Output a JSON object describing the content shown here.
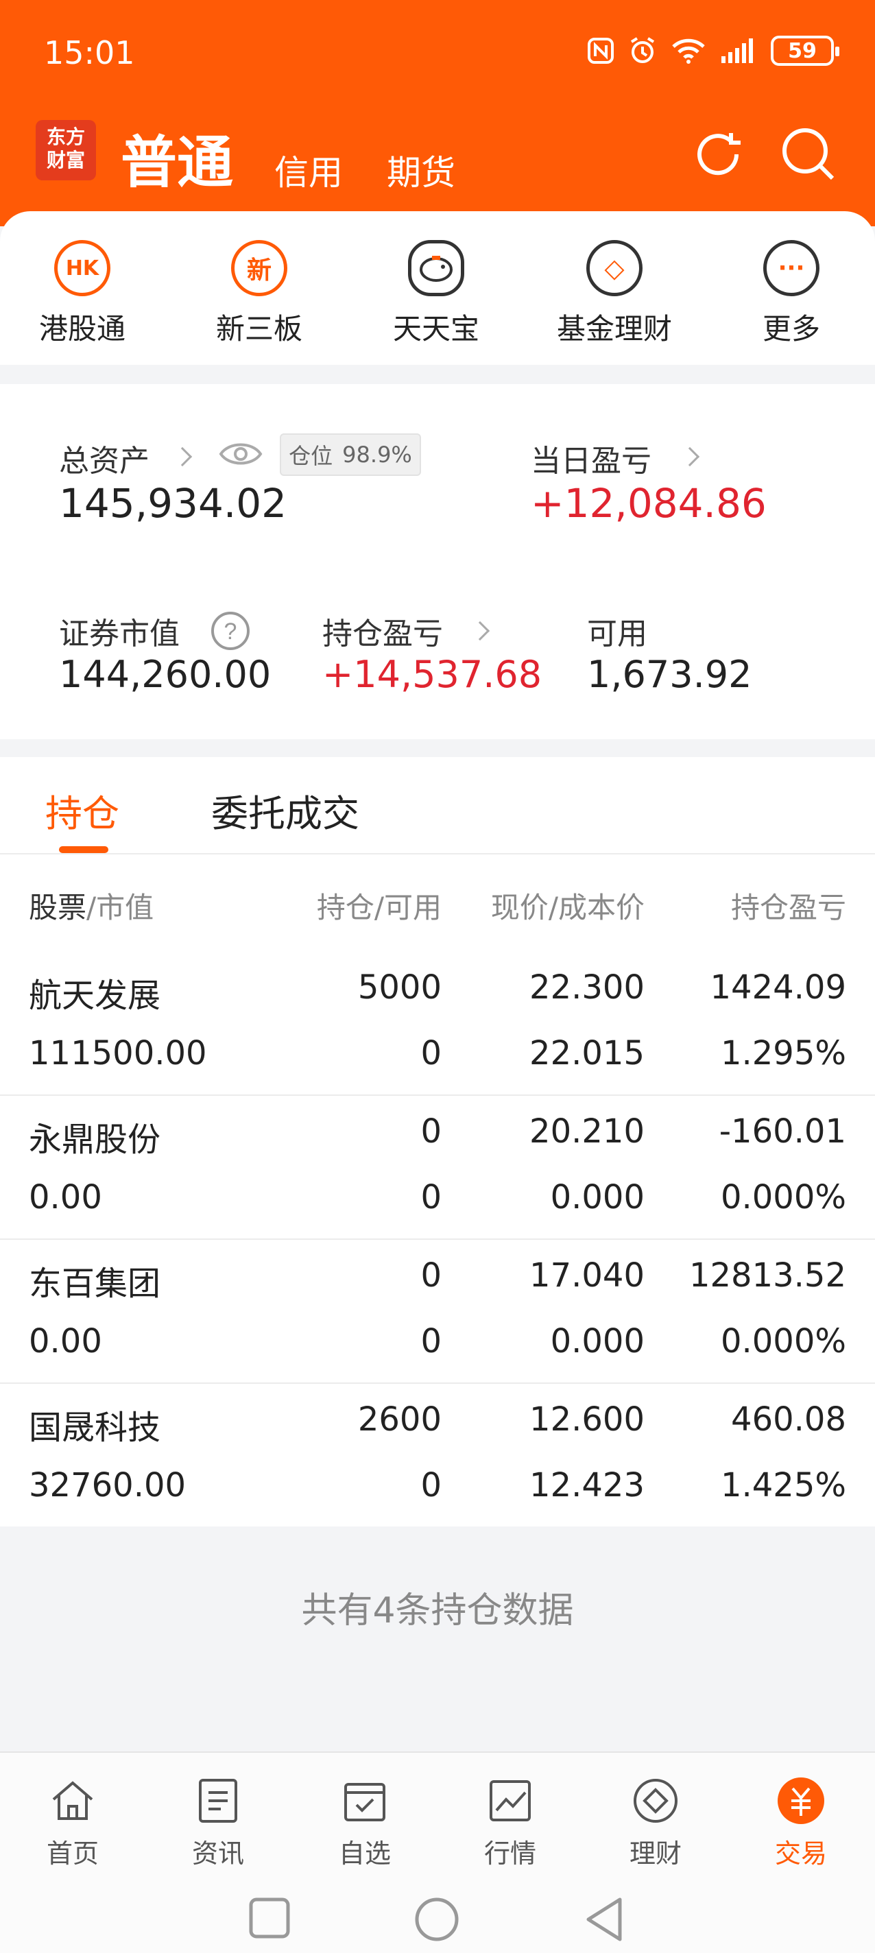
{
  "status": {
    "time": "15:01",
    "battery": "59"
  },
  "header": {
    "logo": [
      "东方",
      "财富"
    ],
    "tabs": [
      "普通",
      "信用",
      "期货"
    ]
  },
  "quick_menu": [
    {
      "label": "港股通",
      "icon": "hk-icon",
      "glyph": "HK"
    },
    {
      "label": "新三板",
      "icon": "new-board-icon",
      "glyph": "新"
    },
    {
      "label": "天天宝",
      "icon": "piggy-bank-icon",
      "glyph": ""
    },
    {
      "label": "基金理财",
      "icon": "fund-diamond-icon",
      "glyph": "◇"
    },
    {
      "label": "更多",
      "icon": "more-icon",
      "glyph": "···"
    }
  ],
  "summary": {
    "total_assets_label": "总资产",
    "position_label": "仓位",
    "position_value": "98.9%",
    "total_assets": "145,934.02",
    "daily_pl_label": "当日盈亏",
    "daily_pl": "+12,084.86",
    "market_value_label": "证券市值",
    "market_value": "144,260.00",
    "holding_pl_label": "持仓盈亏",
    "holding_pl": "+14,537.68",
    "available_label": "可用",
    "available": "1,673.92"
  },
  "list_tabs": [
    "持仓",
    "委托成交"
  ],
  "columns": {
    "stock": "股票",
    "stock_sub": "/市值",
    "holding": "持仓/可用",
    "price": "现价/成本价",
    "pl": "持仓盈亏"
  },
  "holdings": [
    {
      "name": "航天发展",
      "value": "111500.00",
      "hold": "5000",
      "avail": "0",
      "price": "22.300",
      "cost": "22.015",
      "pl": "1424.09",
      "pl_pct": "1.295%",
      "pl_color": "red",
      "pct_color": "red"
    },
    {
      "name": "永鼎股份",
      "value": "0.00",
      "hold": "0",
      "avail": "0",
      "price": "20.210",
      "cost": "0.000",
      "pl": "-160.01",
      "pl_pct": "0.000%",
      "pl_color": "green",
      "pct_color": "green"
    },
    {
      "name": "东百集团",
      "value": "0.00",
      "hold": "0",
      "avail": "0",
      "price": "17.040",
      "cost": "0.000",
      "pl": "12813.52",
      "pl_pct": "0.000%",
      "pl_color": "red",
      "pct_color": "red"
    },
    {
      "name": "国晟科技",
      "value": "32760.00",
      "hold": "2600",
      "avail": "0",
      "price": "12.600",
      "cost": "12.423",
      "pl": "460.08",
      "pl_pct": "1.425%",
      "pl_color": "red",
      "pct_color": "red"
    }
  ],
  "footer_note": "共有4条持仓数据",
  "bottom_nav": [
    {
      "label": "首页",
      "icon": "home-icon"
    },
    {
      "label": "资讯",
      "icon": "news-icon"
    },
    {
      "label": "自选",
      "icon": "watchlist-icon"
    },
    {
      "label": "行情",
      "icon": "market-chart-icon"
    },
    {
      "label": "理财",
      "icon": "wealth-diamond-icon"
    },
    {
      "label": "交易",
      "icon": "trade-yuan-icon",
      "active": true
    }
  ],
  "colors": {
    "brand": "#ff5a06",
    "up": "#e0242f",
    "down": "#16a01f"
  }
}
